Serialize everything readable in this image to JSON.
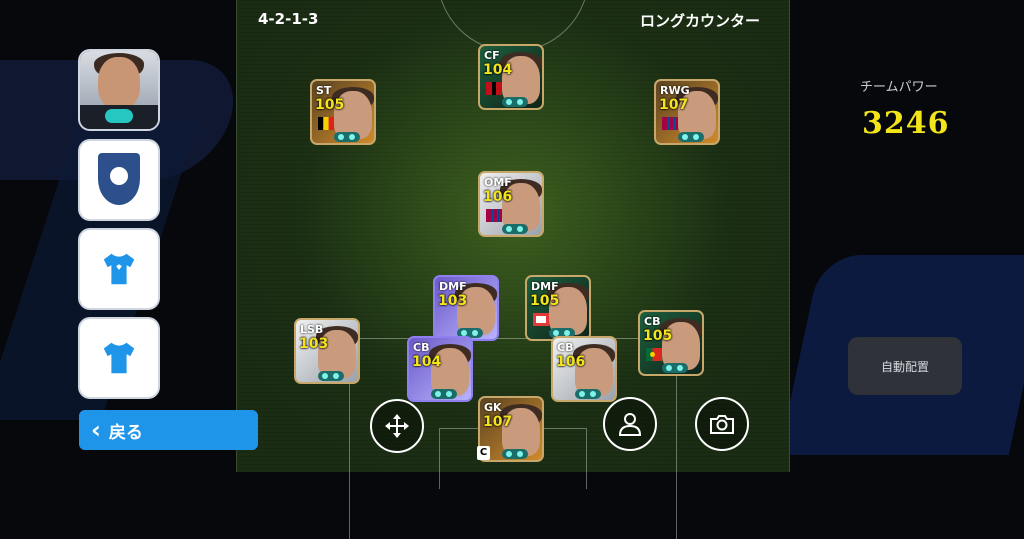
{
  "header": {
    "formation": "4-2-1-3",
    "tactic": "ロングカウンター"
  },
  "team_power": {
    "label": "チームパワー",
    "value": "3246"
  },
  "buttons": {
    "auto_arrange": "自動配置",
    "back": "戻る",
    "back_chevron": "‹"
  },
  "icons": {
    "move": "move-arrows-icon",
    "profile": "person-icon",
    "camera": "camera-icon",
    "manager": "manager-avatar",
    "emblem": "team-emblem-icon",
    "home_kit": "shirt-icon",
    "away_kit": "shirt-icon"
  },
  "colors": {
    "rating": "#f3e51a",
    "accent": "#1f95ea",
    "power": "#f3e51a"
  },
  "players": [
    {
      "id": "cf",
      "position": "CF",
      "rating": "104"
    },
    {
      "id": "st",
      "position": "ST",
      "rating": "105"
    },
    {
      "id": "rwg",
      "position": "RWG",
      "rating": "107"
    },
    {
      "id": "omf",
      "position": "OMF",
      "rating": "106"
    },
    {
      "id": "dmf-left",
      "position": "DMF",
      "rating": "103"
    },
    {
      "id": "dmf-right",
      "position": "DMF",
      "rating": "105"
    },
    {
      "id": "lsb",
      "position": "LSB",
      "rating": "103"
    },
    {
      "id": "cb-left",
      "position": "CB",
      "rating": "104"
    },
    {
      "id": "cb-mid",
      "position": "CB",
      "rating": "106"
    },
    {
      "id": "cb-right",
      "position": "CB",
      "rating": "105"
    },
    {
      "id": "gk",
      "position": "GK",
      "rating": "107"
    }
  ],
  "captain_mark": "C"
}
